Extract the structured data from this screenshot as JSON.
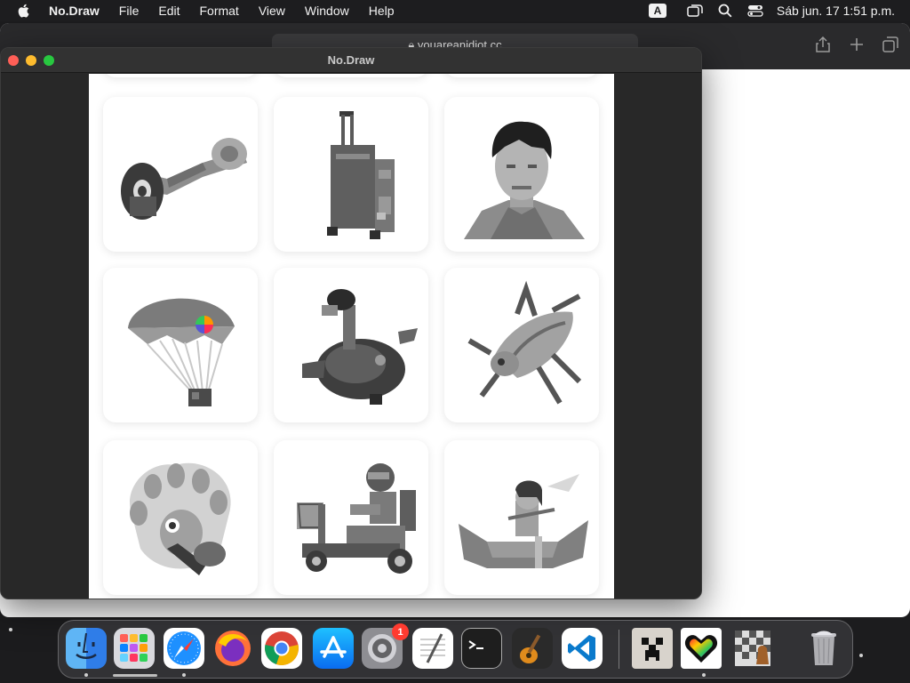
{
  "menubar": {
    "app_name": "No.Draw",
    "items": [
      "File",
      "Edit",
      "Format",
      "View",
      "Window",
      "Help"
    ],
    "input_source": "A",
    "clock": "Sáb jun. 17  1:51 p.m."
  },
  "safari": {
    "url": "youareanidiot.cc"
  },
  "window": {
    "title": "No.Draw",
    "gallery": [
      {
        "name": "hoverboard"
      },
      {
        "name": "suitcase"
      },
      {
        "name": "portrait"
      },
      {
        "name": "parachute"
      },
      {
        "name": "rider-machine"
      },
      {
        "name": "grasshopper"
      },
      {
        "name": "peacock"
      },
      {
        "name": "mobility-scooter"
      },
      {
        "name": "canoe"
      }
    ]
  },
  "dock": {
    "apps": [
      "Finder",
      "Launchpad",
      "Safari",
      "Firefox",
      "Chrome",
      "App Store",
      "System Settings",
      "TextEdit",
      "Terminal",
      "GarageBand",
      "Visual Studio Code",
      "Creeper",
      "Pixel Heart",
      "Chess",
      "Trash"
    ],
    "settings_badge": "1"
  },
  "colors": {
    "menubar_bg": "#1d1d1f",
    "window_bg": "#282828",
    "close": "#ff5f57",
    "minimize": "#febc2e",
    "maximize": "#28c840"
  }
}
